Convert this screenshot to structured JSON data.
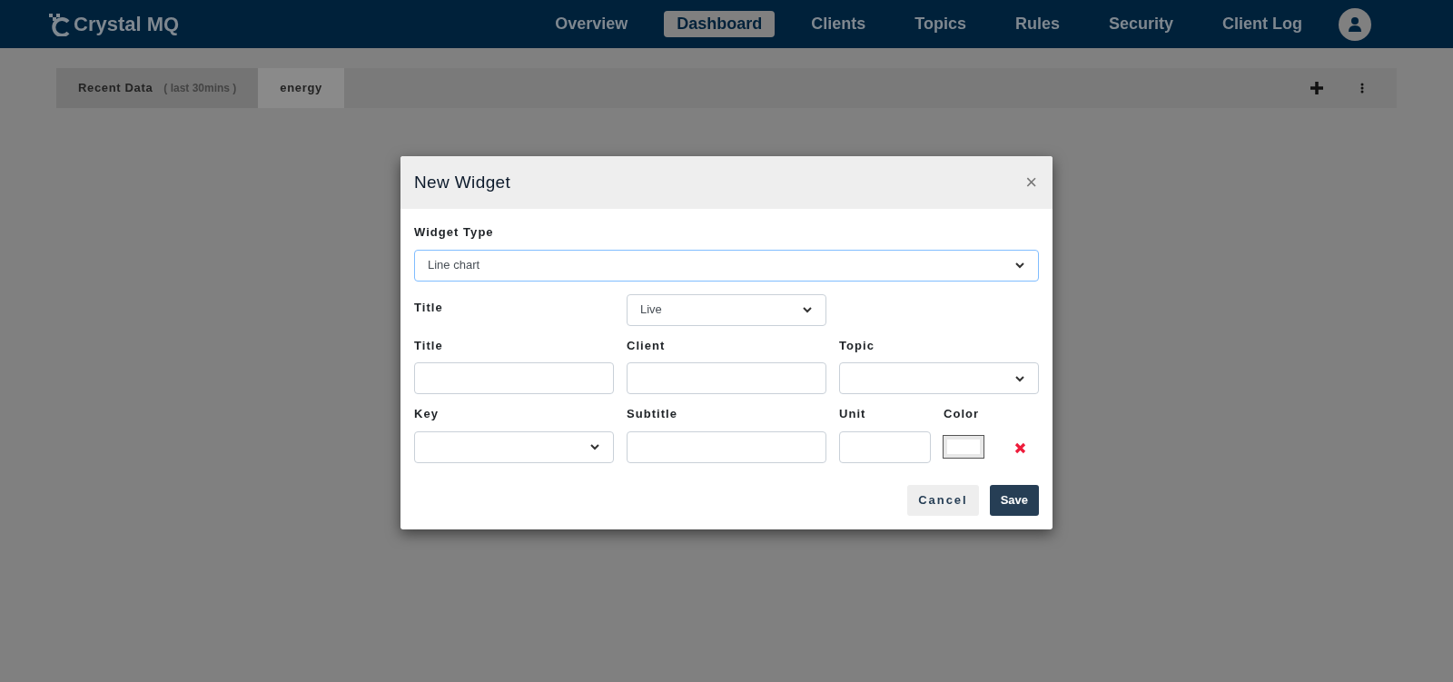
{
  "header": {
    "logo": "Crystal MQ",
    "nav": [
      {
        "label": "Overview",
        "selected": false
      },
      {
        "label": "Dashboard",
        "selected": true
      },
      {
        "label": "Clients",
        "selected": false
      },
      {
        "label": "Topics",
        "selected": false
      },
      {
        "label": "Rules",
        "selected": false
      },
      {
        "label": "Security",
        "selected": false
      },
      {
        "label": "Client Log",
        "selected": false
      }
    ]
  },
  "tabs": [
    {
      "label": "Recent Data",
      "note": "( last 30mins )",
      "selected": false
    },
    {
      "label": "energy",
      "selected": true
    }
  ],
  "dialog": {
    "title": "New Widget",
    "close": "×",
    "widget_type": {
      "label": "Widget Type",
      "value": "Line chart",
      "focused": true
    },
    "mode": {
      "label": "Title",
      "value": "Live",
      "focused": false
    },
    "fields": [
      {
        "label": "Title",
        "kind": "text"
      },
      {
        "label": "Client",
        "kind": "text"
      },
      {
        "label": "Topic",
        "kind": "select"
      }
    ],
    "series_fields": [
      {
        "label": "Key",
        "kind": "select"
      },
      {
        "label": "Subtitle",
        "kind": "text"
      },
      {
        "label": "Unit",
        "kind": "text"
      },
      {
        "label": "Color",
        "kind": "color",
        "color": "#ffffff"
      }
    ],
    "buttons": [
      {
        "label": "Cancel",
        "kind": "secondary"
      },
      {
        "label": "Save",
        "kind": "primary"
      }
    ]
  }
}
